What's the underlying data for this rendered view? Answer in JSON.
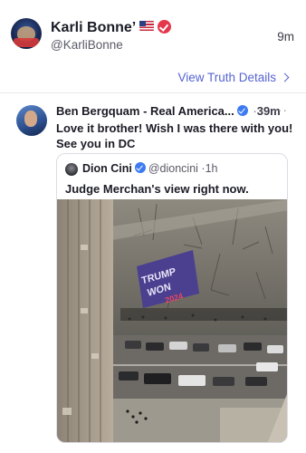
{
  "post": {
    "author_name": "Karli Bonne’",
    "author_handle": "@KarliBonne",
    "time": "9m",
    "view_details_label": "View Truth Details"
  },
  "reply": {
    "author_name": "Ben Bergquam - Real America...",
    "separator": "·",
    "time": "39m",
    "more_icon": "···",
    "text": "Love it brother! Wish I was there with you! See you in DC"
  },
  "quote": {
    "author_name": "Dion Cini",
    "author_handle": "@dioncini",
    "separator": "·",
    "time": "1h",
    "text": "Judge Merchan's view right now.",
    "image": {
      "banner_text_lines": [
        "TRUMP",
        "WON",
        "2024"
      ]
    }
  },
  "colors": {
    "accent": "#5664d2",
    "verified_red": "#e5364c",
    "verified_blue": "#3d7cf0",
    "banner_purple": "#4b3f8f"
  },
  "icons": {
    "flag": "us-flag-icon",
    "verified_main": "verified-badge-red-icon",
    "verified_reply": "verified-badge-blue-icon",
    "chevron": "chevron-right-icon",
    "more": "more-options-icon"
  }
}
